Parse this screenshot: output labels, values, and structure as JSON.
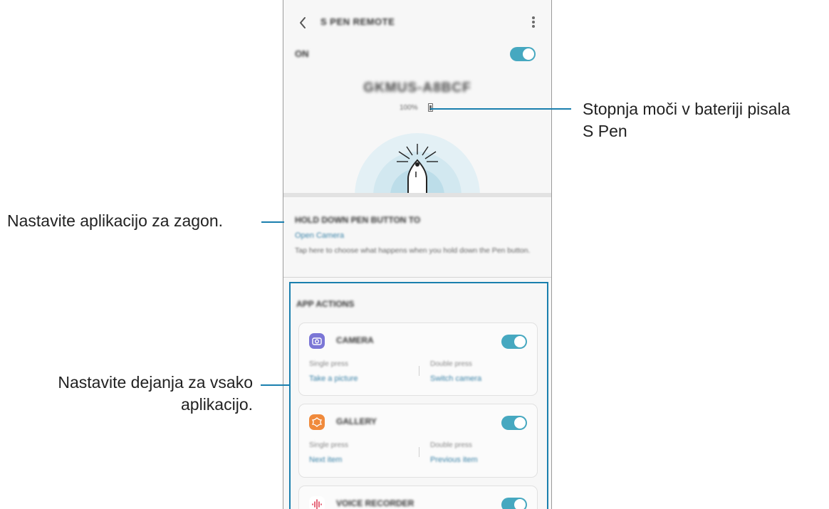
{
  "screen": {
    "title": "S PEN REMOTE",
    "on_label": "ON",
    "device_name": "GKMUS-A8BCF",
    "battery_text": "100%",
    "hold_section": {
      "title": "HOLD DOWN PEN BUTTON TO",
      "value": "Open Camera",
      "description": "Tap here to choose what happens when you hold down the Pen button."
    },
    "app_actions": {
      "title": "APP ACTIONS",
      "apps": [
        {
          "name": "CAMERA",
          "single_label": "Single press",
          "single_value": "Take a picture",
          "double_label": "Double press",
          "double_value": "Switch camera",
          "icon": "camera-icon",
          "icon_color": "#7b76d6"
        },
        {
          "name": "GALLERY",
          "single_label": "Single press",
          "single_value": "Next item",
          "double_label": "Double press",
          "double_value": "Previous item",
          "icon": "gallery-icon",
          "icon_color": "#f08a3c"
        },
        {
          "name": "VOICE RECORDER",
          "icon": "voice-recorder-icon",
          "icon_color": "#e0425a"
        }
      ]
    },
    "accent_color": "#46a8c0"
  },
  "callouts": {
    "battery_line1": "Stopnja moči v bateriji pisala",
    "battery_line2": "S Pen",
    "launch_app": "Nastavite aplikacijo za zagon.",
    "actions_line1": "Nastavite dejanja za vsako",
    "actions_line2": "aplikacijo."
  }
}
